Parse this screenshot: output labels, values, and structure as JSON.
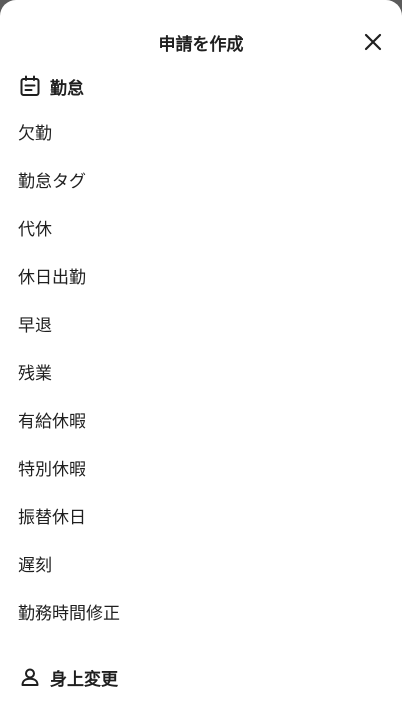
{
  "header": {
    "title": "申請を作成",
    "close_icon": "close-icon"
  },
  "sections": [
    {
      "label": "勤怠",
      "icon": "calendar-icon",
      "items": [
        "欠勤",
        "勤怠タグ",
        "代休",
        "休日出勤",
        "早退",
        "残業",
        "有給休暇",
        "特別休暇",
        "振替休日",
        "遅刻",
        "勤務時間修正"
      ]
    },
    {
      "label": "身上変更",
      "icon": "person-icon",
      "items": []
    }
  ]
}
